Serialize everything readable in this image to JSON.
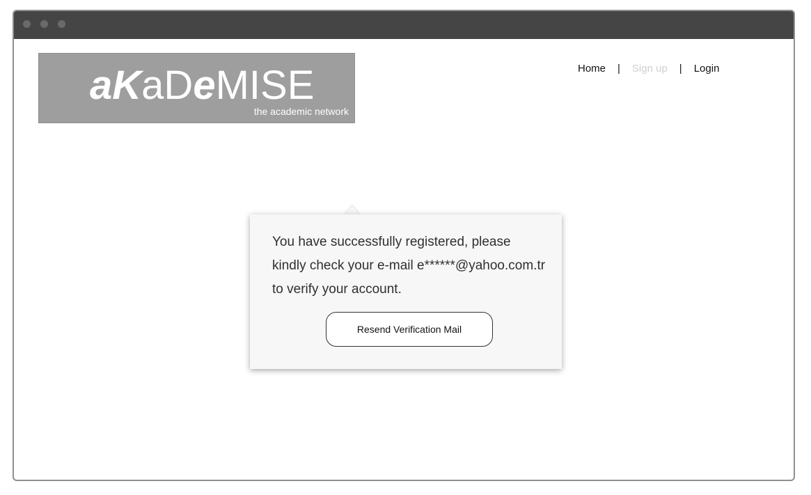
{
  "logo": {
    "parts": [
      {
        "text": "a",
        "style": "bold-italic"
      },
      {
        "text": "K",
        "style": "bold-italic"
      },
      {
        "text": "a",
        "style": "normal"
      },
      {
        "text": "D",
        "style": "normal"
      },
      {
        "text": "e",
        "style": "bold-italic"
      },
      {
        "text": "MISE",
        "style": "normal"
      }
    ],
    "tagline": "the academic network"
  },
  "nav": {
    "home": "Home",
    "separator": "|",
    "signup": "Sign up",
    "login": "Login"
  },
  "popup": {
    "message": "You have successfully registered, please kindly check your e-mail e******@yahoo.com.tr to verify your account.",
    "button_label": "Resend Verification Mail"
  },
  "colors": {
    "titlebar": "#454545",
    "logo_background": "#9e9e9e",
    "disabled_nav": "#cfcfcf",
    "popup_background": "#f7f7f7"
  }
}
